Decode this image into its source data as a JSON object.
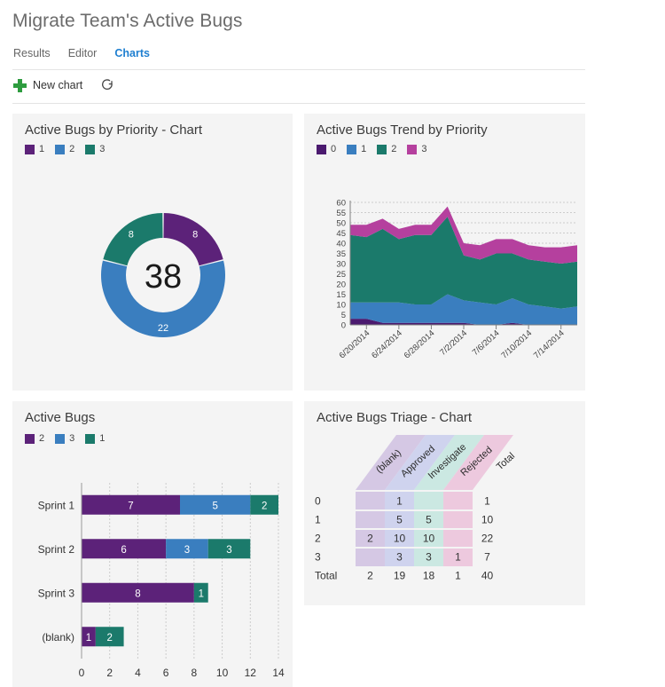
{
  "header": {
    "title": "Migrate Team's Active Bugs",
    "tabs": [
      {
        "label": "Results",
        "active": false
      },
      {
        "label": "Editor",
        "active": false
      },
      {
        "label": "Charts",
        "active": true
      }
    ],
    "toolbar": {
      "new_chart_label": "New chart",
      "new_chart_icon": "plus-icon",
      "refresh_icon": "refresh-icon"
    }
  },
  "colors": {
    "purple": "#5C2279",
    "blue": "#3A7EBF",
    "teal": "#1B7A6B",
    "magenta": "#B5409E",
    "dark_purple": "#4B1A6F",
    "card_bg": "#f4f4f4",
    "accent": "#1f7fd0",
    "plus_green": "#2e9c3f",
    "header_blank": "#d5c8e4",
    "header_approved": "#cfd3ee",
    "header_investigate": "#cbe8e2",
    "header_rejected": "#edc9de"
  },
  "cards": [
    {
      "id": "donut",
      "title": "Active Bugs by Priority - Chart"
    },
    {
      "id": "trend",
      "title": "Active Bugs Trend by Priority"
    },
    {
      "id": "bars",
      "title": "Active Bugs"
    },
    {
      "id": "triage",
      "title": "Active Bugs Triage - Chart"
    }
  ],
  "chart_data": [
    {
      "id": "donut",
      "type": "pie",
      "title": "Active Bugs by Priority - Chart",
      "subtype": "donut",
      "center_label": "38",
      "total": 38,
      "legend": [
        "1",
        "2",
        "3"
      ],
      "legend_position": "top-left",
      "categories": [
        "1",
        "2",
        "3"
      ],
      "values": [
        8,
        22,
        8
      ],
      "slice_colors": [
        "#5C2279",
        "#3A7EBF",
        "#1B7A6B"
      ],
      "data_labels": [
        "8",
        "22",
        "8"
      ]
    },
    {
      "id": "trend",
      "type": "area",
      "title": "Active Bugs Trend by Priority",
      "stacked": true,
      "legend": [
        "0",
        "1",
        "2",
        "3"
      ],
      "legend_position": "top-left",
      "xlabel": "",
      "ylabel": "",
      "ylim": [
        0,
        60
      ],
      "yticks": [
        0,
        5,
        10,
        15,
        20,
        25,
        30,
        35,
        40,
        45,
        50,
        55,
        60
      ],
      "grid": true,
      "xticks": [
        "6/20/2014",
        "6/24/2014",
        "6/28/2014",
        "7/2/2014",
        "7/6/2014",
        "7/10/2014",
        "7/14/2014"
      ],
      "x": [
        "6/18/2014",
        "6/20/2014",
        "6/22/2014",
        "6/24/2014",
        "6/26/2014",
        "6/28/2014",
        "6/30/2014",
        "7/2/2014",
        "7/4/2014",
        "7/6/2014",
        "7/8/2014",
        "7/10/2014",
        "7/12/2014",
        "7/14/2014",
        "7/16/2014"
      ],
      "series": [
        {
          "name": "0",
          "color": "#4B1A6F",
          "values": [
            3,
            3,
            1,
            1,
            1,
            1,
            1,
            1,
            0,
            0,
            1,
            0,
            0,
            0,
            0
          ]
        },
        {
          "name": "1",
          "color": "#3A7EBF",
          "values": [
            8,
            8,
            10,
            10,
            9,
            9,
            14,
            11,
            11,
            10,
            12,
            10,
            9,
            8,
            9
          ]
        },
        {
          "name": "2",
          "color": "#1B7A6B",
          "values": [
            33,
            32,
            36,
            31,
            34,
            34,
            38,
            22,
            21,
            25,
            22,
            22,
            22,
            22,
            22
          ]
        },
        {
          "name": "3",
          "color": "#B5409E",
          "values": [
            5,
            6,
            5,
            5,
            5,
            5,
            5,
            6,
            7,
            7,
            7,
            7,
            7,
            8,
            8
          ]
        }
      ]
    },
    {
      "id": "bars",
      "type": "bar",
      "title": "Active Bugs",
      "orientation": "horizontal",
      "stacked": true,
      "legend": [
        "2",
        "3",
        "1"
      ],
      "legend_position": "top-left",
      "categories": [
        "Sprint 1",
        "Sprint 2",
        "Sprint 3",
        "(blank)"
      ],
      "xlim": [
        0,
        14
      ],
      "xticks": [
        0,
        2,
        4,
        6,
        8,
        10,
        12,
        14
      ],
      "grid": true,
      "series": [
        {
          "name": "2",
          "color": "#5C2279",
          "values": [
            7,
            6,
            8,
            1
          ]
        },
        {
          "name": "3",
          "color": "#3A7EBF",
          "values": [
            5,
            3,
            0,
            0
          ]
        },
        {
          "name": "1",
          "color": "#1B7A6B",
          "values": [
            2,
            3,
            1,
            2
          ]
        }
      ]
    },
    {
      "id": "triage",
      "type": "table",
      "title": "Active Bugs Triage - Chart",
      "corner_label": "",
      "columns": [
        "(blank)",
        "Approved",
        "Investigate",
        "Rejected",
        "Total"
      ],
      "column_colors": [
        "#d5c8e4",
        "#cfd3ee",
        "#cbe8e2",
        "#edc9de",
        "#f4f4f4"
      ],
      "row_headers": [
        "0",
        "1",
        "2",
        "3",
        "Total"
      ],
      "rows": [
        {
          "header": "0",
          "cells": [
            "",
            "1",
            "",
            "",
            "1"
          ]
        },
        {
          "header": "1",
          "cells": [
            "",
            "5",
            "5",
            "",
            "10"
          ]
        },
        {
          "header": "2",
          "cells": [
            "2",
            "10",
            "10",
            "",
            "22"
          ]
        },
        {
          "header": "3",
          "cells": [
            "",
            "3",
            "3",
            "1",
            "7"
          ]
        },
        {
          "header": "Total",
          "cells": [
            "2",
            "19",
            "18",
            "1",
            "40"
          ]
        }
      ]
    }
  ]
}
